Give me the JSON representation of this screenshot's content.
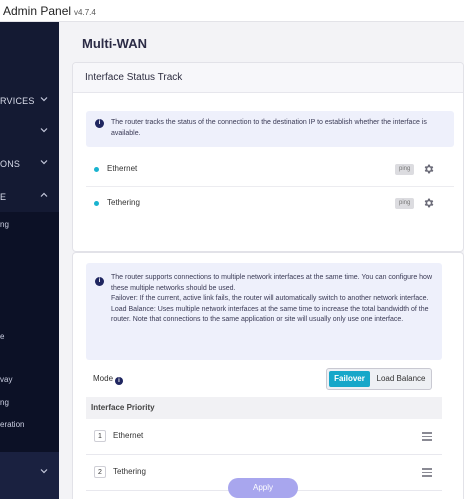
{
  "app": {
    "title": "Admin Panel",
    "version": "v4.7.4"
  },
  "sidebar": {
    "items": [
      {
        "label": "RVICES"
      },
      {
        "label": ""
      },
      {
        "label": "ONS"
      },
      {
        "label": "E"
      }
    ],
    "subitems": [
      {
        "label": "ng"
      },
      {
        "label": "e"
      },
      {
        "label": "vay"
      },
      {
        "label": "ng"
      },
      {
        "label": "eration"
      }
    ]
  },
  "page": {
    "title": "Multi-WAN"
  },
  "status_track": {
    "title": "Interface Status Track",
    "info": "The router tracks the status of the connection to the destination IP to establish whether the interface is available.",
    "rows": [
      {
        "name": "Ethernet",
        "method": "ping"
      },
      {
        "name": "Tethering",
        "method": "ping"
      }
    ]
  },
  "multiwan": {
    "info_lines": [
      "The router supports connections to multiple network interfaces at the same time. You can configure how these multiple networks should be used.",
      "Failover: If the current, active link fails, the router will automatically switch to another network interface.",
      "Load Balance: Uses multiple network interfaces at the same time to increase the total bandwidth of the router. Note that connections to the same application or site will usually only use one interface."
    ],
    "mode_label": "Mode",
    "mode_options": [
      "Failover",
      "Load Balance"
    ],
    "mode_selected": "Failover",
    "priority_title": "Interface Priority",
    "priority": [
      {
        "num": "1",
        "name": "Ethernet"
      },
      {
        "num": "2",
        "name": "Tethering"
      }
    ],
    "apply_label": "Apply"
  },
  "colors": {
    "accent": "#16a7c9",
    "sidebar": "#141a33",
    "apply": "#a8a6ee"
  }
}
